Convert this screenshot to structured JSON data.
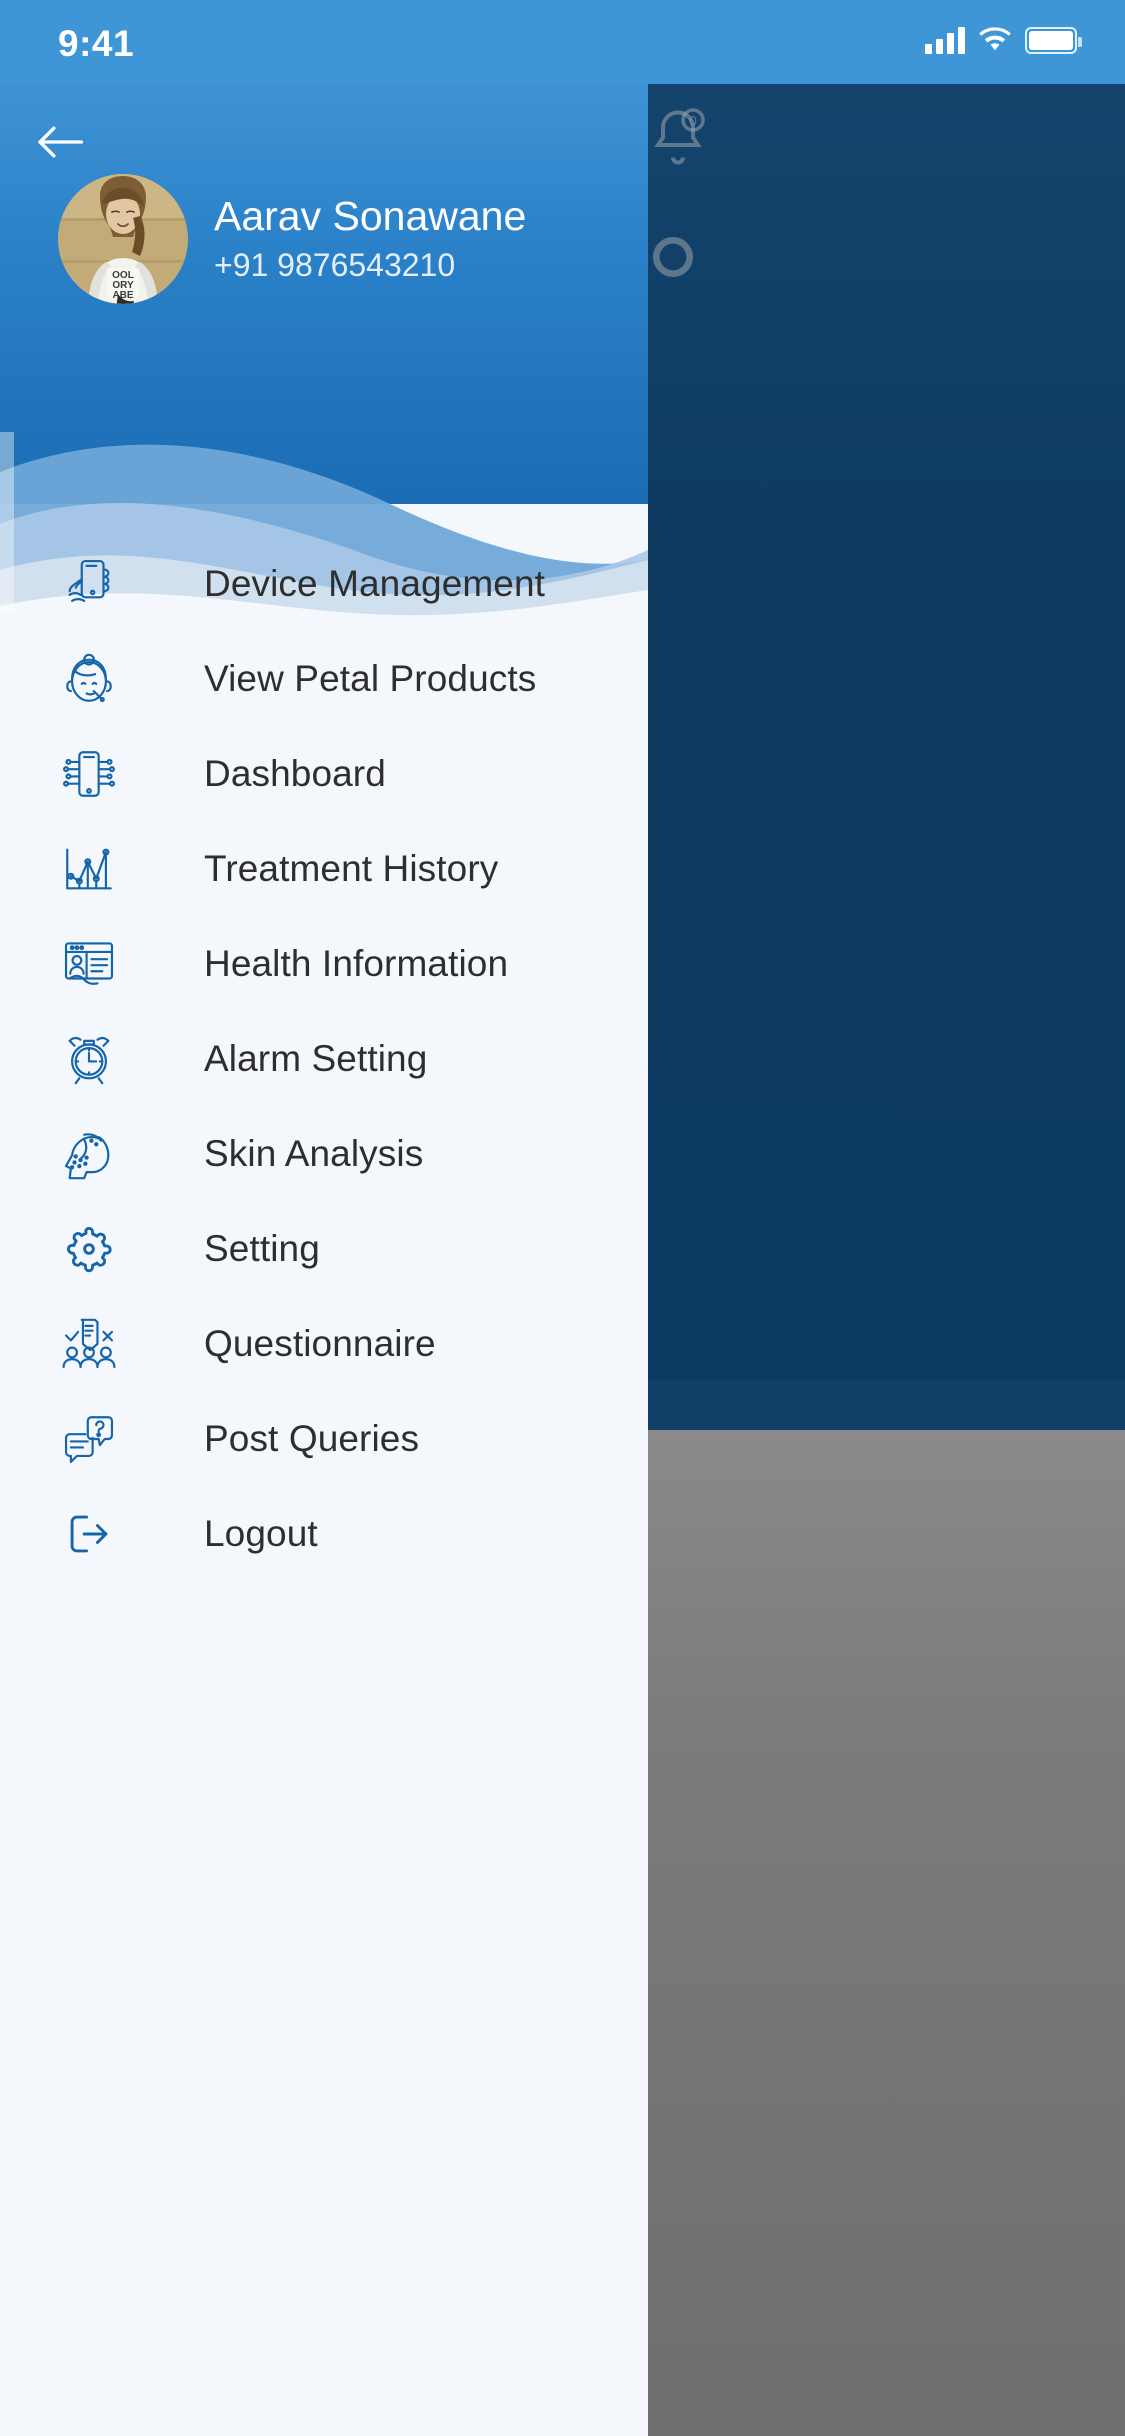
{
  "status_bar": {
    "time": "9:41",
    "icons": [
      "cellular-signal-icon",
      "wifi-icon",
      "battery-icon"
    ]
  },
  "drawer": {
    "back_icon": "back-arrow-icon",
    "profile": {
      "avatar": "user-avatar-photo",
      "name": "Aarav Sonawane",
      "phone": "+91 9876543210"
    },
    "menu": [
      {
        "label": "Device Management",
        "icon": "hand-holding-phone-icon"
      },
      {
        "label": "View Petal Products",
        "icon": "face-beauty-icon"
      },
      {
        "label": "Dashboard",
        "icon": "smartphone-circuit-icon"
      },
      {
        "label": "Treatment History",
        "icon": "line-chart-icon"
      },
      {
        "label": "Health Information",
        "icon": "profile-window-icon"
      },
      {
        "label": "Alarm Setting",
        "icon": "alarm-clock-icon"
      },
      {
        "label": "Skin Analysis",
        "icon": "face-profile-skin-icon"
      },
      {
        "label": "Setting",
        "icon": "gear-icon"
      },
      {
        "label": "Questionnaire",
        "icon": "survey-people-icon"
      },
      {
        "label": "Post Queries",
        "icon": "chat-question-icon"
      },
      {
        "label": "Logout",
        "icon": "logout-arrow-icon"
      }
    ]
  },
  "background": {
    "icons": [
      "notification-bell-icon",
      "circle-button-icon"
    ]
  },
  "colors": {
    "status_bar": "#3f96d6",
    "header_top": "#3f93d4",
    "header_bottom": "#1b6cb4",
    "drawer_bg": "#f4f8fc",
    "icon_blue": "#1565a8",
    "label_text": "#2e2e2e",
    "scrim_dark": "#0e3a60",
    "scrim_gray": "#7b7b7b"
  }
}
